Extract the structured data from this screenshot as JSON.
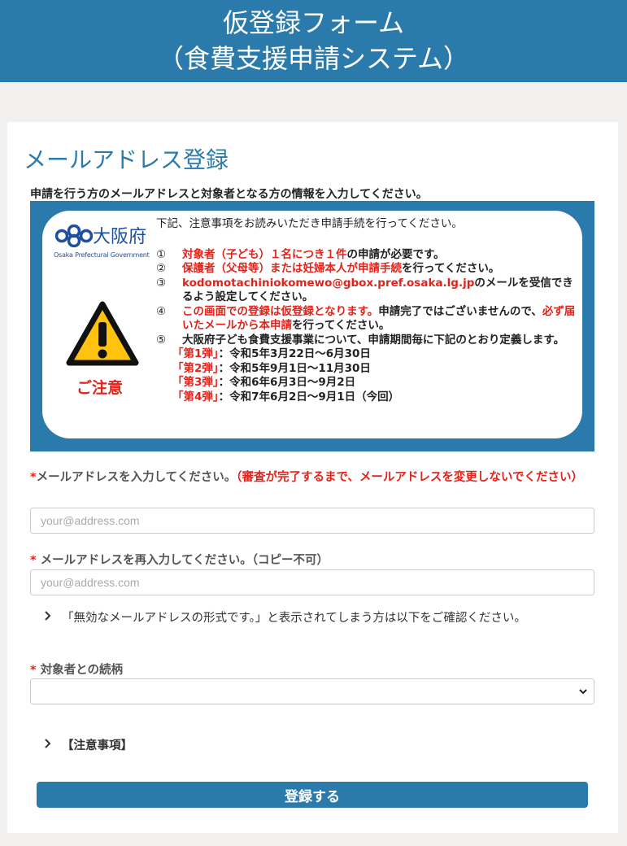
{
  "header": {
    "title_line1": "仮登録フォーム",
    "title_line2": "（食費支援申請システム）"
  },
  "form": {
    "title": "メールアドレス登録",
    "intro": "申請を行う方のメールアドレスと対象者となる方の情報を入力してください。"
  },
  "notice": {
    "logo_text": "大阪府",
    "logo_sub": "Osaka Prefectural Government",
    "warning_label": "ご注意",
    "lead": "下記、注意事項をお読みいただき申請手続を行ってください。",
    "items": [
      {
        "num": "①",
        "red": "対象者（子ども）１名につき１件",
        "rest": "の申請が必要です。"
      },
      {
        "num": "②",
        "red": "保護者（父母等）または妊婦本人が申請手続",
        "rest": "を行ってください。"
      },
      {
        "num": "③",
        "red": "kodomotachiniokomewo@gbox.pref.osaka.lg.jp",
        "rest": "のメールを受信できるよう設定してください。"
      },
      {
        "num": "④",
        "red": "この画面での登録は仮登録となります。",
        "rest": "申請完了ではございませんので、",
        "red2": "必ず届いたメールから本申請",
        "rest2": "を行ってください。"
      },
      {
        "num": "⑤",
        "text": "大阪府子ども食費支援事業について、申請期間毎に下記のとおり定義します。"
      }
    ],
    "phases": [
      {
        "name": "「第1弾」",
        "period": "：令和5年3月22日～6月30日"
      },
      {
        "name": "「第2弾」",
        "period": "：令和5年9月1日～11月30日"
      },
      {
        "name": "「第3弾」",
        "period": "：令和6年6月3日～9月2日"
      },
      {
        "name": "「第4弾」",
        "period": "：令和7年6月2日～9月1日（今回）"
      }
    ]
  },
  "email": {
    "required_mark": "*",
    "label": "メールアドレスを入力してください。",
    "warning": "（審査が完了するまで、メールアドレスを変更しないでください）",
    "placeholder": "your@address.com"
  },
  "email_confirm": {
    "required_mark": "*",
    "label": "メールアドレスを再入力してください。（コピー不可）",
    "placeholder": "your@address.com"
  },
  "invalid_email_help": "「無効なメールアドレスの形式です。」と表示されてしまう方は以下をご確認ください。",
  "relationship": {
    "required_mark": "*",
    "label": "対象者との続柄",
    "selected": ""
  },
  "notes_toggle": "【注意事項】",
  "submit_label": "登録する",
  "colors": {
    "brand": "#2a7bac",
    "warning_red": "#e2231a"
  }
}
